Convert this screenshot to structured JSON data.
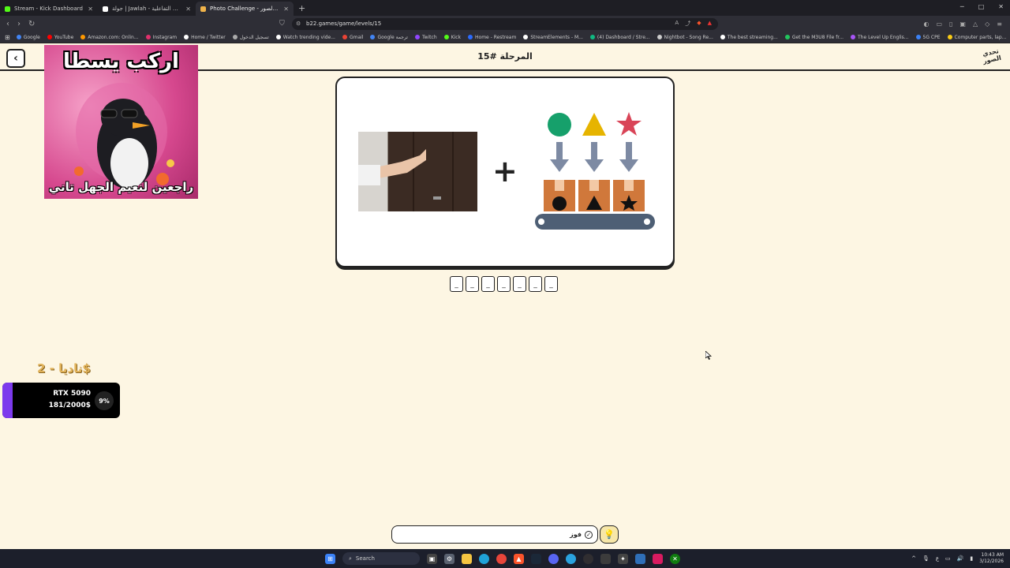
{
  "browser": {
    "tabs": [
      {
        "title": "Stream - Kick Dashboard",
        "color": "#53fc18",
        "active": false
      },
      {
        "title": "جولة | Jawlah - منصة الألعاب التفاعلية",
        "color": "#ffffff",
        "active": false
      },
      {
        "title": "Photo Challenge - تحدي الصور",
        "color": "#f0b34a",
        "active": true
      }
    ],
    "new_tab": "+",
    "url": "b22.games/game/levels/15",
    "bookmarks": [
      {
        "label": "Google",
        "color": "#4285f4"
      },
      {
        "label": "YouTube",
        "color": "#ff0000"
      },
      {
        "label": "Amazon.com: Onlin...",
        "color": "#ff9900"
      },
      {
        "label": "Instagram",
        "color": "#e1306c"
      },
      {
        "label": "Home / Twitter",
        "color": "#ffffff"
      },
      {
        "label": "تسجيل الدخول",
        "color": "#aaaaaa"
      },
      {
        "label": "Watch trending vide...",
        "color": "#ffffff"
      },
      {
        "label": "Gmail",
        "color": "#ea4335"
      },
      {
        "label": "Google ترجمة",
        "color": "#4285f4"
      },
      {
        "label": "Twitch",
        "color": "#9146ff"
      },
      {
        "label": "Kick",
        "color": "#53fc18"
      },
      {
        "label": "Home - Restream",
        "color": "#2b6bff"
      },
      {
        "label": "StreamElements - M...",
        "color": "#ffffff"
      },
      {
        "label": "(4) Dashboard / Stre...",
        "color": "#10b981"
      },
      {
        "label": "Nightbot - Song Re...",
        "color": "#cccccc"
      },
      {
        "label": "The best streaming...",
        "color": "#ffffff"
      },
      {
        "label": "Get the M3U8 File fr...",
        "color": "#22c55e"
      },
      {
        "label": "The Level Up Englis...",
        "color": "#a855f7"
      },
      {
        "label": "5G CPE",
        "color": "#3b82f6"
      },
      {
        "label": "Computer parts, lap...",
        "color": "#facc15"
      }
    ]
  },
  "page": {
    "back_icon": "chevron-left-icon",
    "level_title": "المرحلة #15",
    "logo_text": "تحدي الصور"
  },
  "overlay": {
    "top_text": "اركب يسطا",
    "bottom_text": "راجعين لنعيم الجهل تاني"
  },
  "puzzle": {
    "plus": "+",
    "answer_slots": [
      "_",
      "_",
      "_",
      "_",
      "_",
      "_",
      "_"
    ],
    "shapes": [
      {
        "name": "circle",
        "color": "#16a06b"
      },
      {
        "name": "triangle",
        "color": "#e6b400"
      },
      {
        "name": "star",
        "color": "#d94457"
      }
    ]
  },
  "donation": {
    "donor": "ناديا - 2$"
  },
  "goal": {
    "title": "RTX 5090",
    "progress": "181/2000$",
    "percent": "9%",
    "fill_fraction": 0.09,
    "color": "#7c3aed"
  },
  "input": {
    "value": "فوز",
    "submit_icon": "check-circle-icon",
    "hint_icon": "lightbulb-icon"
  },
  "taskbar": {
    "search": "Search",
    "time": "10:43 AM",
    "date": "3/12/2026"
  }
}
